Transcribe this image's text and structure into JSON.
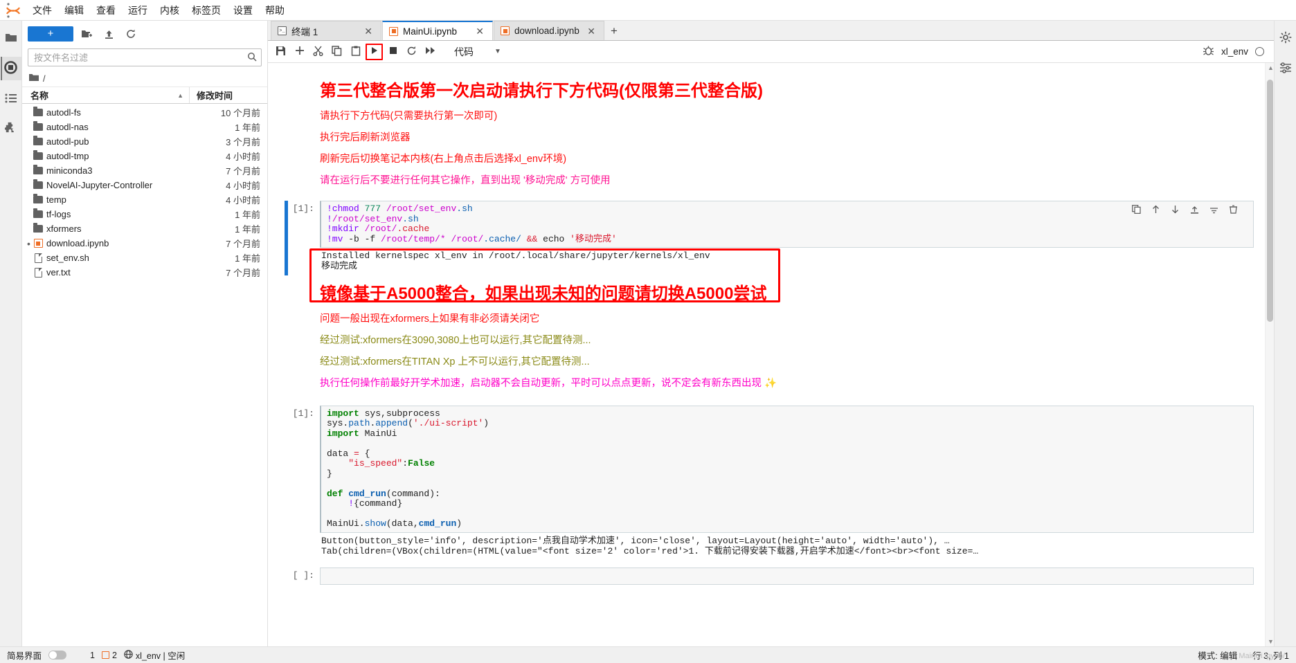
{
  "menubar": {
    "logo": "jupyter-logo",
    "items": [
      {
        "label": "文件"
      },
      {
        "label": "编辑"
      },
      {
        "label": "查看"
      },
      {
        "label": "运行"
      },
      {
        "label": "内核"
      },
      {
        "label": "标签页"
      },
      {
        "label": "设置"
      },
      {
        "label": "帮助"
      }
    ]
  },
  "activitybar": {
    "items": [
      {
        "name": "file-browser",
        "icon": "folder-icon"
      },
      {
        "name": "running-terminals",
        "icon": "stop-circle-icon"
      },
      {
        "name": "table-of-contents",
        "icon": "list-icon"
      },
      {
        "name": "extension-manager",
        "icon": "puzzle-icon"
      }
    ]
  },
  "filebrowser": {
    "new_button": "+",
    "toolbar_icons": [
      "new-folder-icon",
      "upload-icon",
      "refresh-icon"
    ],
    "filter_placeholder": "按文件名过滤",
    "filter_value": "",
    "breadcrumb": "/",
    "columns": {
      "name": "名称",
      "modified": "修改时间"
    },
    "items": [
      {
        "name": "autodl-fs",
        "modified": "10 个月前",
        "type": "folder",
        "marker": false
      },
      {
        "name": "autodl-nas",
        "modified": "1 年前",
        "type": "folder",
        "marker": false
      },
      {
        "name": "autodl-pub",
        "modified": "3 个月前",
        "type": "folder",
        "marker": false
      },
      {
        "name": "autodl-tmp",
        "modified": "4 小时前",
        "type": "folder",
        "marker": false
      },
      {
        "name": "miniconda3",
        "modified": "7 个月前",
        "type": "folder",
        "marker": false
      },
      {
        "name": "NovelAI-Jupyter-Controller",
        "modified": "4 小时前",
        "type": "folder",
        "marker": false
      },
      {
        "name": "temp",
        "modified": "4 小时前",
        "type": "folder",
        "marker": false
      },
      {
        "name": "tf-logs",
        "modified": "1 年前",
        "type": "folder",
        "marker": false
      },
      {
        "name": "xformers",
        "modified": "1 年前",
        "type": "folder",
        "marker": false
      },
      {
        "name": "download.ipynb",
        "modified": "7 个月前",
        "type": "notebook",
        "marker": true
      },
      {
        "name": "set_env.sh",
        "modified": "1 年前",
        "type": "file",
        "marker": false
      },
      {
        "name": "ver.txt",
        "modified": "7 个月前",
        "type": "file",
        "marker": false
      }
    ]
  },
  "tabs": [
    {
      "label": "终端 1",
      "icon": "terminal-icon",
      "active": false
    },
    {
      "label": "MainUi.ipynb",
      "icon": "notebook-icon",
      "active": true
    },
    {
      "label": "download.ipynb",
      "icon": "notebook-icon",
      "active": false
    }
  ],
  "notebook_toolbar": {
    "buttons": [
      {
        "name": "save-button",
        "icon": "save-icon"
      },
      {
        "name": "insert-cell-button",
        "icon": "plus-icon"
      },
      {
        "name": "cut-cell-button",
        "icon": "scissors-icon"
      },
      {
        "name": "copy-cell-button",
        "icon": "copy-icon"
      },
      {
        "name": "paste-cell-button",
        "icon": "clipboard-icon"
      },
      {
        "name": "run-cell-button",
        "icon": "play-icon",
        "highlighted": true
      },
      {
        "name": "interrupt-kernel-button",
        "icon": "stop-icon"
      },
      {
        "name": "restart-kernel-button",
        "icon": "restart-icon"
      },
      {
        "name": "restart-run-all-button",
        "icon": "fast-forward-icon"
      }
    ],
    "celltype": "代码",
    "kernel_name": "xl_env",
    "bug_icon": "bug-icon",
    "kernel_status_icon": "idle-circle-icon"
  },
  "notebook": {
    "markdown_1": {
      "heading": "第三代整合版第一次启动请执行下方代码(仅限第三代整合版)",
      "lines": [
        "请执行下方代码(只需要执行第一次即可)",
        "执行完后刷新浏览器",
        "刷新完后切换笔记本内核(右上角点击后选择xl_env环境)"
      ],
      "warning": "请在运行后不要进行任何其它操作，直到出现 '移动完成' 方可使用"
    },
    "cell_1": {
      "prompt": "[1]:",
      "line1_bang": "!chmod",
      "line1_num": "777",
      "line1_path": "/root/set_env",
      "line1_ext": ".sh",
      "line2_bang": "!",
      "line2_path": "/root/set_env",
      "line2_ext": ".sh",
      "line3_bang": "!mkdir",
      "line3_path": "/root/",
      "line3_ext": ".cache",
      "line4_bang": "!mv",
      "line4_flags": "-b -f",
      "line4_p1": "/root/temp/*",
      "line4_p2": "/root/",
      "line4_p3": ".cache/",
      "line4_op": "&&",
      "line4_echo": "echo",
      "line4_str": "'移动完成'",
      "output_line1": "Installed kernelspec xl_env in /root/.local/share/jupyter/kernels/xl_env",
      "output_line2": "移动完成",
      "toolbar_icons": [
        "duplicate-icon",
        "move-up-icon",
        "move-down-icon",
        "insert-above-icon",
        "insert-below-icon",
        "delete-icon"
      ]
    },
    "markdown_2": {
      "heading": "镜像基于A5000整合，如果出现未知的问题请切换A5000尝试",
      "line_red": "问题一般出现在xformers上如果有非必须请关闭它",
      "line_olive_1": "经过测试:xformers在3090,3080上也可以运行,其它配置待测...",
      "line_olive_2": "经过测试:xformers在TITAN Xp 上不可以运行,其它配置待测...",
      "line_magenta": "执行任何操作前最好开学术加速，启动器不会自动更新，平时可以点点更新，说不定会有新东西出现 ✨"
    },
    "cell_2": {
      "prompt": "[1]:",
      "code_lines": [
        "import sys,subprocess",
        "sys.path.append('./ui-script')",
        "import MainUi",
        "",
        "data = {",
        "    \"is_speed\":False",
        "}",
        "",
        "def cmd_run(command):",
        "    !{command}",
        "",
        "MainUi.show(data,cmd_run)"
      ],
      "output_line1": "Button(button_style='info', description='点我自动学术加速', icon='close', layout=Layout(height='auto', width='auto'), …",
      "output_line2": "Tab(children=(VBox(children=(HTML(value=\"<font size='2' color='red'>1. 下载前记得安装下载器,开启学术加速</font><br><font size=…"
    },
    "cell_3": {
      "prompt": "[ ]:"
    }
  },
  "rightbar": {
    "items": [
      {
        "name": "settings",
        "icon": "gear-icon"
      },
      {
        "name": "property-inspector",
        "icon": "sliders-icon"
      }
    ]
  },
  "statusbar": {
    "simple_mode_label": "简易界面",
    "terminals_count": "1",
    "kernels_count": "2",
    "kernel_status": "xl_env | 空闲",
    "mode": "模式: 编辑",
    "cursor": "行 3, 列 1",
    "watermark": "MainUi.ipynb/"
  }
}
